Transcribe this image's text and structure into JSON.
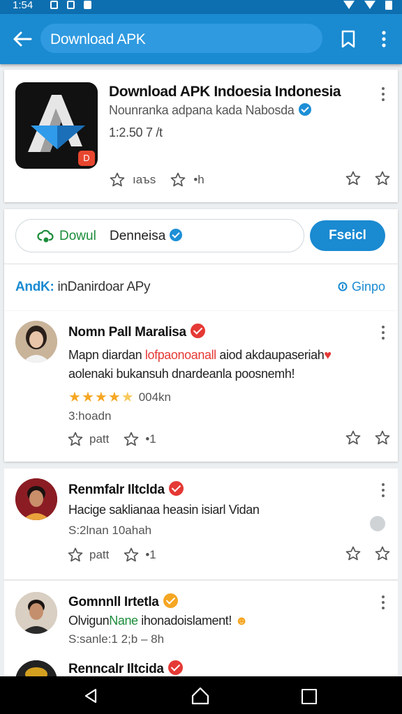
{
  "status_bar": {
    "time": "1:54"
  },
  "app_bar": {
    "search_text": "Download APK"
  },
  "app_card": {
    "title": "Download APK Indoesia Indonesia",
    "developer": "Nounranka adpana kada Nabosda",
    "size": "1:2.50 7 /t",
    "badge": "D",
    "like_label": "ıaъs",
    "share_label": "•h"
  },
  "download_card": {
    "download_label": "Dowul",
    "download_name": "Denneisa",
    "install_label": "Fseicl",
    "tagline_prefix": "AndK:",
    "tagline_rest": " inDanirdoar APy",
    "compare_label": "Ginpo"
  },
  "reviews": [
    {
      "name": "Nomn Pall Maralisa",
      "text_line1_a": "Mapn diardan ",
      "text_line1_red": "lofpaonoanall",
      "text_line1_b": " aiod akdaupaseriah",
      "text_line2": "aolenaki bukansuh dnardeanla poosnemh!",
      "rating": 4.5,
      "rating_count": "004kn",
      "meta": "3:hoadn",
      "like_label": "patt",
      "share_label": "•1"
    },
    {
      "name": "Renmfalr Iltclda",
      "text_line1": "Hacige saklianaa heasin isiarl Vidan",
      "meta": "S:2lnan 10ahah",
      "like_label": "patt",
      "share_label": "•1"
    },
    {
      "name": "Gomnnll Irtetla",
      "text_line1_a": "Olvigun",
      "text_line1_green": "Nane",
      "text_line1_b": " ihonadoislament!",
      "meta": "S:sanle:1 2;b –  8h"
    },
    {
      "name": "Renncalr Iltcida"
    }
  ],
  "colors": {
    "primary": "#1a8ad1",
    "status_bar": "#0d6fb0",
    "verified": "#1d8fd6",
    "badge_red": "#e53935",
    "badge_orange": "#f5a623",
    "download_green": "#1b8c3a"
  },
  "icons": [
    "back-arrow-icon",
    "bookmark-icon",
    "overflow-menu-icon",
    "verified-icon",
    "star-outline-icon",
    "cloud-download-icon",
    "nav-back-icon",
    "nav-home-icon",
    "nav-recents-icon"
  ]
}
